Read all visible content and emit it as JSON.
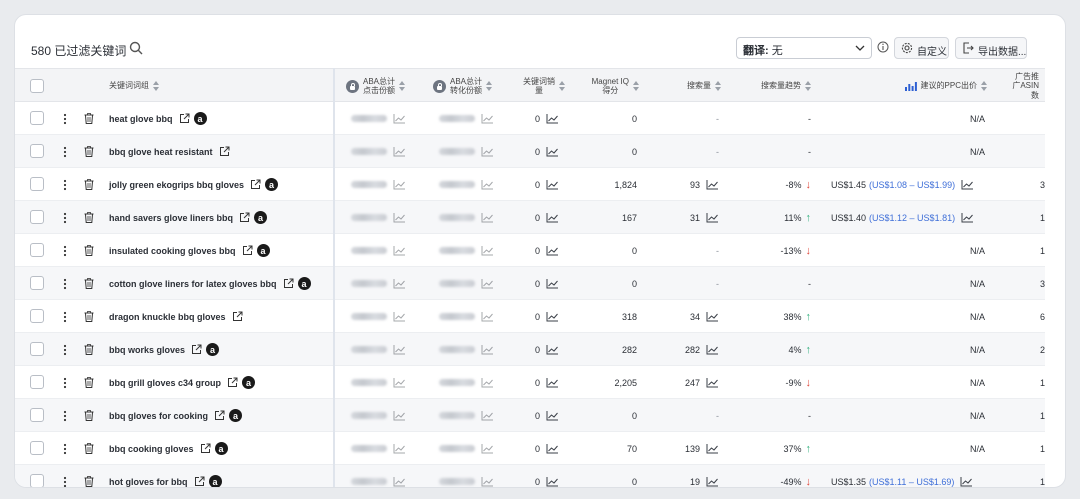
{
  "toolbar": {
    "filtered_count": "580 已过滤关键词",
    "translate_label": "翻译:",
    "translate_value": "无",
    "customize_label": "自定义",
    "export_label": "导出数据..."
  },
  "columns": {
    "keyword_group": "关键词词组",
    "aba_click_share_1": "ABA总计",
    "aba_click_share_2": "点击份额",
    "aba_conv_share_1": "ABA总计",
    "aba_conv_share_2": "转化份额",
    "kw_sales_1": "关键词销",
    "kw_sales_2": "量",
    "magnet_iq_1": "Magnet IQ",
    "magnet_iq_2": "得分",
    "search_volume": "搜索量",
    "search_trend": "搜索量趋势",
    "ppc_bid": "建议的PPC出价",
    "ad_asin_1": "广告推",
    "ad_asin_2": "广ASIN",
    "ad_asin_3": "数"
  },
  "rows": [
    {
      "keyword": "heat glove bbq",
      "amazon": true,
      "sales": "0",
      "iq": "0",
      "volume": "-",
      "volume_trend": false,
      "trend": "-",
      "trend_dir": "",
      "ppc": "N/A",
      "ppc_range": "",
      "asin": ""
    },
    {
      "keyword": "bbq glove heat resistant",
      "amazon": false,
      "sales": "0",
      "iq": "0",
      "volume": "-",
      "volume_trend": false,
      "trend": "-",
      "trend_dir": "",
      "ppc": "N/A",
      "ppc_range": "",
      "asin": ""
    },
    {
      "keyword": "jolly green ekogrips bbq gloves",
      "amazon": true,
      "sales": "0",
      "iq": "1,824",
      "volume": "93",
      "volume_trend": true,
      "trend": "-8%",
      "trend_dir": "down",
      "ppc": "US$1.45",
      "ppc_range": "(US$1.08 – US$1.99)",
      "asin": "3"
    },
    {
      "keyword": "hand savers glove liners bbq",
      "amazon": true,
      "sales": "0",
      "iq": "167",
      "volume": "31",
      "volume_trend": true,
      "trend": "11%",
      "trend_dir": "up",
      "ppc": "US$1.40",
      "ppc_range": "(US$1.12 – US$1.81)",
      "asin": "1"
    },
    {
      "keyword": "insulated cooking gloves bbq",
      "amazon": true,
      "sales": "0",
      "iq": "0",
      "volume": "-",
      "volume_trend": false,
      "trend": "-13%",
      "trend_dir": "down",
      "ppc": "N/A",
      "ppc_range": "",
      "asin": "1"
    },
    {
      "keyword": "cotton glove liners for latex gloves bbq",
      "amazon": true,
      "sales": "0",
      "iq": "0",
      "volume": "-",
      "volume_trend": false,
      "trend": "-",
      "trend_dir": "",
      "ppc": "N/A",
      "ppc_range": "",
      "asin": "3"
    },
    {
      "keyword": "dragon knuckle bbq gloves",
      "amazon": false,
      "sales": "0",
      "iq": "318",
      "volume": "34",
      "volume_trend": true,
      "trend": "38%",
      "trend_dir": "up",
      "ppc": "N/A",
      "ppc_range": "",
      "asin": "6"
    },
    {
      "keyword": "bbq works gloves",
      "amazon": true,
      "sales": "0",
      "iq": "282",
      "volume": "282",
      "volume_trend": true,
      "trend": "4%",
      "trend_dir": "up",
      "ppc": "N/A",
      "ppc_range": "",
      "asin": "2"
    },
    {
      "keyword": "bbq grill gloves c34 group",
      "amazon": true,
      "sales": "0",
      "iq": "2,205",
      "volume": "247",
      "volume_trend": true,
      "trend": "-9%",
      "trend_dir": "down",
      "ppc": "N/A",
      "ppc_range": "",
      "asin": "1"
    },
    {
      "keyword": "bbq gloves for cooking",
      "amazon": true,
      "sales": "0",
      "iq": "0",
      "volume": "-",
      "volume_trend": false,
      "trend": "-",
      "trend_dir": "",
      "ppc": "N/A",
      "ppc_range": "",
      "asin": "1"
    },
    {
      "keyword": "bbq cooking gloves",
      "amazon": true,
      "sales": "0",
      "iq": "70",
      "volume": "139",
      "volume_trend": true,
      "trend": "37%",
      "trend_dir": "up",
      "ppc": "N/A",
      "ppc_range": "",
      "asin": "1"
    },
    {
      "keyword": "hot gloves for bbq",
      "amazon": true,
      "sales": "0",
      "iq": "0",
      "volume": "19",
      "volume_trend": true,
      "trend": "-49%",
      "trend_dir": "down",
      "ppc": "US$1.35",
      "ppc_range": "(US$1.11 – US$1.69)",
      "asin": "1"
    }
  ],
  "icons": {
    "amazon_glyph": "a"
  }
}
